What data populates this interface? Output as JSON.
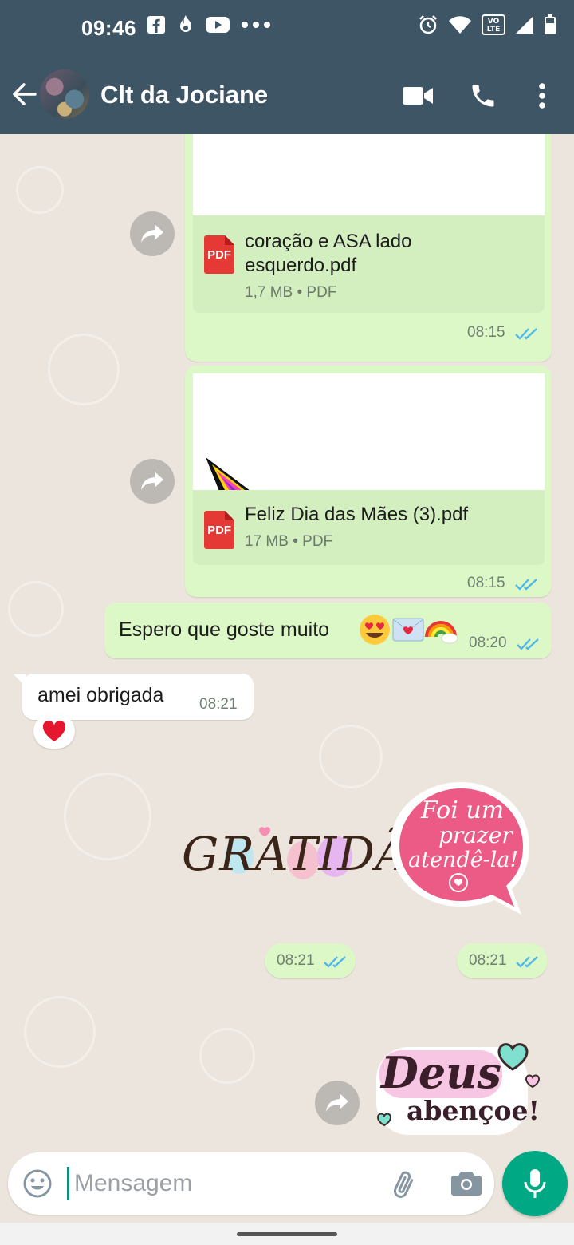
{
  "status_bar": {
    "time": "09:46",
    "icons_left": [
      "facebook-icon",
      "fire-icon",
      "youtube-icon",
      "more-dots-icon"
    ],
    "icons_right": [
      "alarm-icon",
      "wifi-icon",
      "volte-icon",
      "signal-icon",
      "battery-icon"
    ],
    "volte_label": "VO\nLTE"
  },
  "header": {
    "title": "Clt da Jociane",
    "icons": [
      "back-arrow-icon",
      "video-call-icon",
      "voice-call-icon",
      "more-vert-icon"
    ]
  },
  "messages": [
    {
      "type": "document",
      "direction": "outgoing",
      "file_name": "coração e ASA lado esquerdo.pdf",
      "file_name_line1": "coração e ASA lado",
      "file_name_line2": "esquerdo.pdf",
      "size": "1,7 MB",
      "file_type": "PDF",
      "time": "08:15",
      "status": "read"
    },
    {
      "type": "document",
      "direction": "outgoing",
      "file_name": "Feliz Dia das Mães (3).pdf",
      "size": "17 MB",
      "file_type": "PDF",
      "time": "08:15",
      "status": "read"
    },
    {
      "type": "text",
      "direction": "outgoing",
      "text": "Espero que goste muito",
      "emojis": [
        "heart-eyes-emoji",
        "love-letter-emoji",
        "rainbow-emoji"
      ],
      "time": "08:20",
      "status": "read"
    },
    {
      "type": "text",
      "direction": "incoming",
      "text": "amei obrigada",
      "time": "08:21",
      "reaction": "heart-emoji"
    },
    {
      "type": "sticker",
      "direction": "outgoing",
      "sticker_text": "GRATIDÃO",
      "time": "08:21",
      "status": "read"
    },
    {
      "type": "sticker",
      "direction": "outgoing",
      "sticker_text_lines": [
        "Foi um",
        "prazer",
        "atendê-la!"
      ],
      "time": "08:21",
      "status": "read"
    },
    {
      "type": "sticker",
      "direction": "outgoing",
      "sticker_text_lines": [
        "Deus",
        "abençoe!"
      ],
      "status": "read"
    }
  ],
  "pdf_badge": "PDF",
  "composer": {
    "placeholder": "Mensagem",
    "icons": [
      "emoji-icon",
      "attach-icon",
      "camera-icon",
      "mic-icon"
    ]
  },
  "colors": {
    "app_bar": "#3e5565",
    "outgoing_bubble": "#dcf8c6",
    "incoming_bubble": "#ffffff",
    "read_ticks": "#4fb6ec",
    "accent": "#00a884",
    "chat_background": "#ece5dd"
  }
}
